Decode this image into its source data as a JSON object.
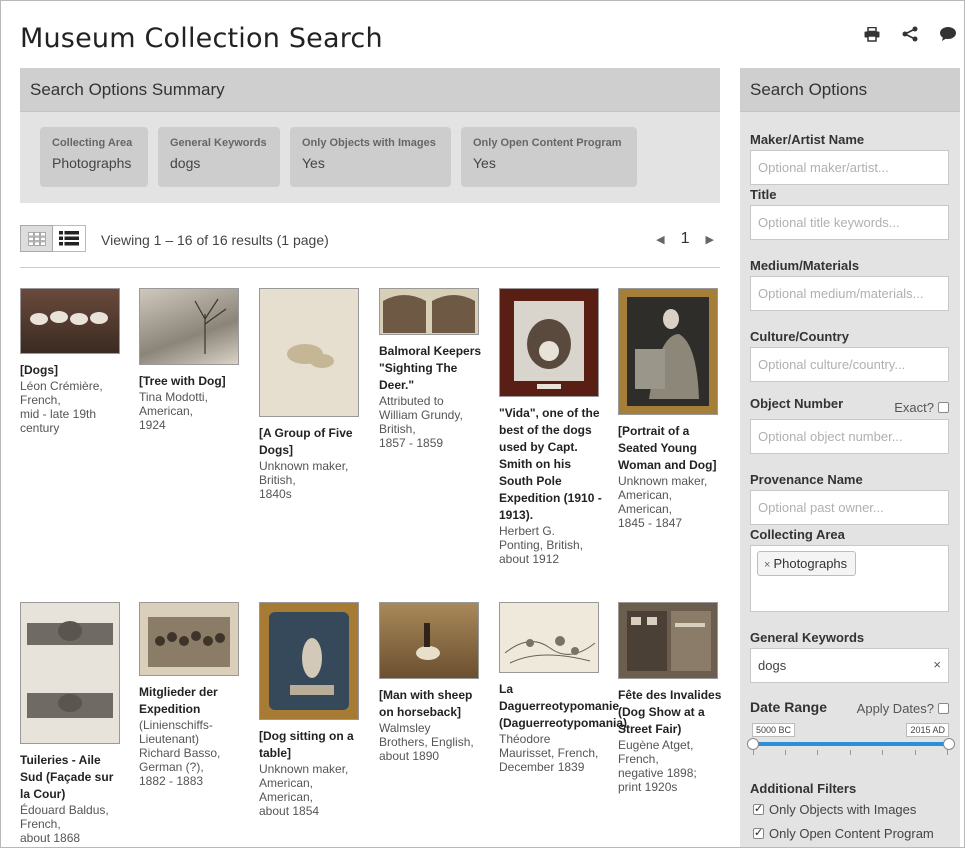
{
  "page": {
    "title": "Museum Collection Search"
  },
  "summary": {
    "heading": "Search Options Summary",
    "chips": [
      {
        "label": "Collecting Area",
        "value": "Photographs"
      },
      {
        "label": "General Keywords",
        "value": "dogs"
      },
      {
        "label": "Only Objects with Images",
        "value": "Yes"
      },
      {
        "label": "Only Open Content Program",
        "value": "Yes"
      }
    ]
  },
  "toolbar": {
    "viewing": "Viewing 1 – 16 of 16 results (1 page)",
    "page_number": "1"
  },
  "results": [
    {
      "title": "[Dogs]",
      "meta": "Léon Crémière,\nFrench,\nmid - late 19th\ncentury"
    },
    {
      "title": "[Tree with Dog]",
      "meta": "Tina Modotti,\nAmerican,\n1924"
    },
    {
      "title": "[A Group of Five Dogs]",
      "meta": "Unknown maker,\nBritish,\n1840s"
    },
    {
      "title": "Balmoral Keepers \"Sighting The Deer.\"",
      "meta": "Attributed to\nWilliam Grundy,\nBritish,\n1857 - 1859"
    },
    {
      "title": "\"Vida\", one of the best of the dogs used by Capt. Smith on his South Pole Expedition (1910 - 1913).",
      "meta": "Herbert G.\nPonting, British,\nabout 1912"
    },
    {
      "title": "[Portrait of a Seated Young Woman and Dog]",
      "meta": "Unknown maker,\nAmerican,\nAmerican,\n1845 - 1847"
    },
    {
      "title": "Tuileries - Aile Sud (Façade sur la Cour)",
      "meta": "Édouard Baldus,\nFrench,\nabout 1868"
    },
    {
      "title": "Mitglieder der Expedition",
      "meta": "(Linienschiffs-\nLieutenant)\nRichard Basso,\nGerman (?),\n1882 - 1883"
    },
    {
      "title": "[Dog sitting on a table]",
      "meta": "Unknown maker,\nAmerican,\nAmerican,\nabout 1854"
    },
    {
      "title": "[Man with sheep on horseback]",
      "meta": "Walmsley\nBrothers, English,\nabout 1890"
    },
    {
      "title": "La Daguerreotypomanie (Daguerreotypomania)",
      "meta": "Théodore\nMaurisset, French,\nDecember 1839"
    },
    {
      "title": "Fête des Invalides (Dog Show at a Street Fair)",
      "meta": "Eugène Atget,\nFrench,\nnegative 1898;\nprint 1920s"
    }
  ],
  "sidebar": {
    "heading": "Search Options",
    "maker": {
      "label": "Maker/Artist Name",
      "placeholder": "Optional maker/artist..."
    },
    "title": {
      "label": "Title",
      "placeholder": "Optional title keywords..."
    },
    "medium": {
      "label": "Medium/Materials",
      "placeholder": "Optional medium/materials..."
    },
    "culture": {
      "label": "Culture/Country",
      "placeholder": "Optional culture/country..."
    },
    "object_number": {
      "label": "Object Number",
      "placeholder": "Optional object number...",
      "exact_label": "Exact?"
    },
    "provenance": {
      "label": "Provenance Name",
      "placeholder": "Optional past owner..."
    },
    "collecting_area": {
      "label": "Collecting Area",
      "tag": "Photographs",
      "tag_remove": "×"
    },
    "keywords": {
      "label": "General Keywords",
      "value": "dogs",
      "clear": "×"
    },
    "date_range": {
      "label": "Date Range",
      "apply_label": "Apply Dates?",
      "min": "5000 BC",
      "max": "2015 AD"
    },
    "additional": {
      "label": "Additional Filters",
      "only_images": "Only Objects with Images",
      "only_open": "Only Open Content Program"
    }
  },
  "colors": {
    "slider": "#2a8fd6",
    "panel": "#e3e3e3",
    "panel_head": "#cfcfcf"
  },
  "icons": [
    "print-icon",
    "share-icon",
    "comment-icon",
    "grid-view-icon",
    "list-view-icon",
    "chevron-left-icon",
    "chevron-right-icon"
  ]
}
